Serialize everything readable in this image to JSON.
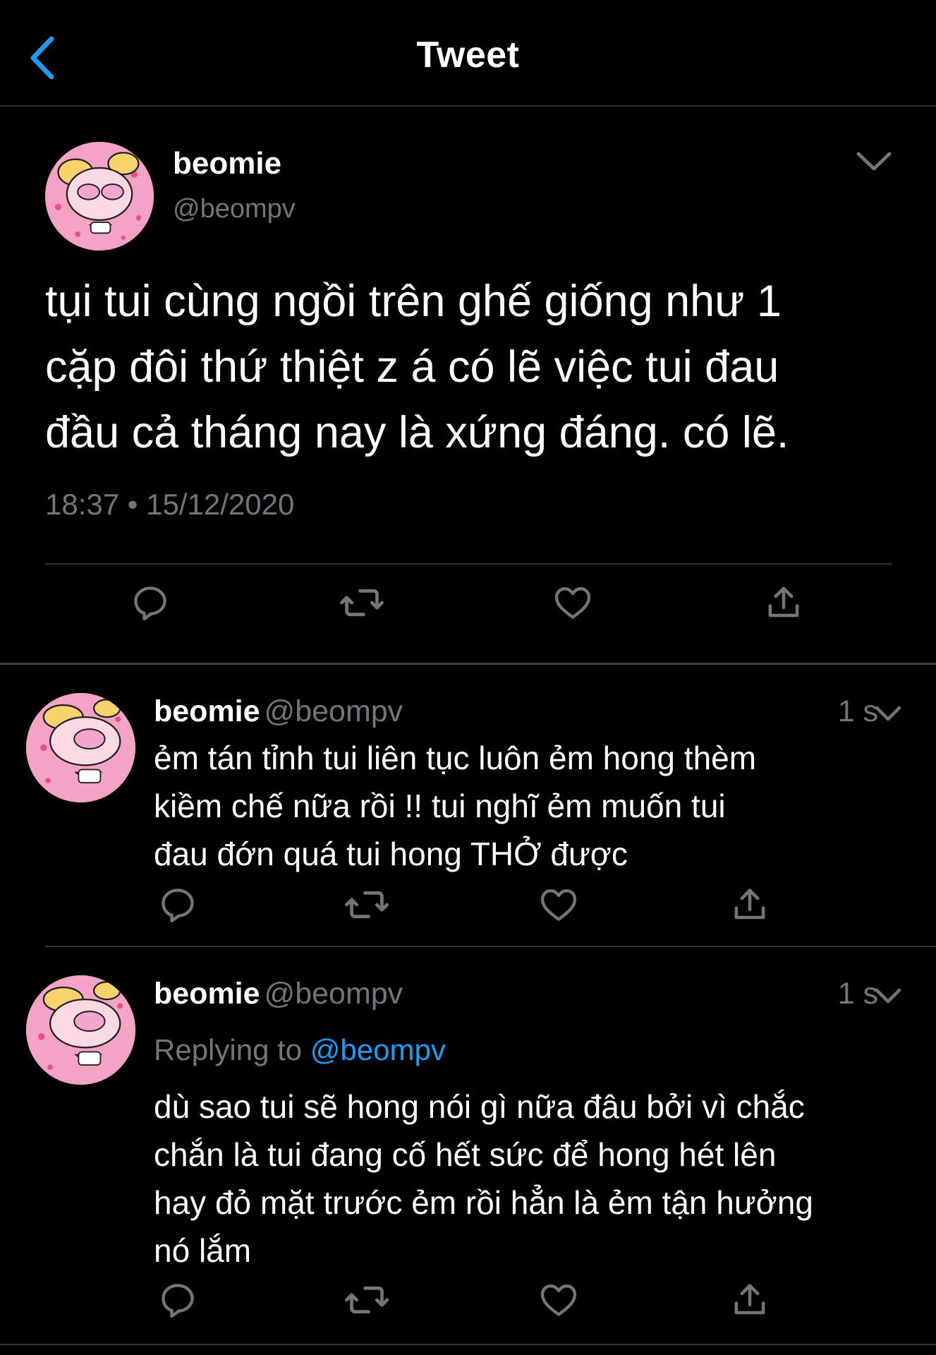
{
  "header": {
    "title": "Tweet",
    "back_icon": "chevron-left-icon",
    "accent_color": "#1d9bf0"
  },
  "main_tweet": {
    "display_name": "beomie",
    "handle": "@beompv",
    "text_lines": [
      "tụi tui cùng ngồi trên ghế giống như 1",
      "cặp đôi thứ thiệt z á có lẽ việc tui đau",
      "đầu cả tháng nay là xứng đáng. có lẽ."
    ],
    "timestamp": "18:37 • 15/12/2020",
    "actions": [
      "reply-icon",
      "retweet-icon",
      "like-icon",
      "share-icon"
    ]
  },
  "replies": [
    {
      "display_name": "beomie",
      "handle": "@beompv",
      "time": "1 s",
      "replying_to_label": "",
      "replying_to_handle": "",
      "text_lines": [
        "ẻm tán tỉnh tui liên tục luôn ẻm hong thèm",
        "kiềm chế nữa rồi !! tui nghĩ ẻm muốn tui",
        "đau đớn quá tui hong THỞ được"
      ]
    },
    {
      "display_name": "beomie",
      "handle": "@beompv",
      "time": "1 s",
      "replying_to_label": "Replying to",
      "replying_to_handle": "@beompv",
      "text_lines": [
        "dù sao tui sẽ hong nói gì nữa đâu bởi vì chắc",
        "chắn là tui đang cố hết sức để hong hét lên",
        "hay đỏ mặt trước ẻm rồi hẳn là ẻm tận hưởng",
        "nó lắm"
      ]
    }
  ]
}
